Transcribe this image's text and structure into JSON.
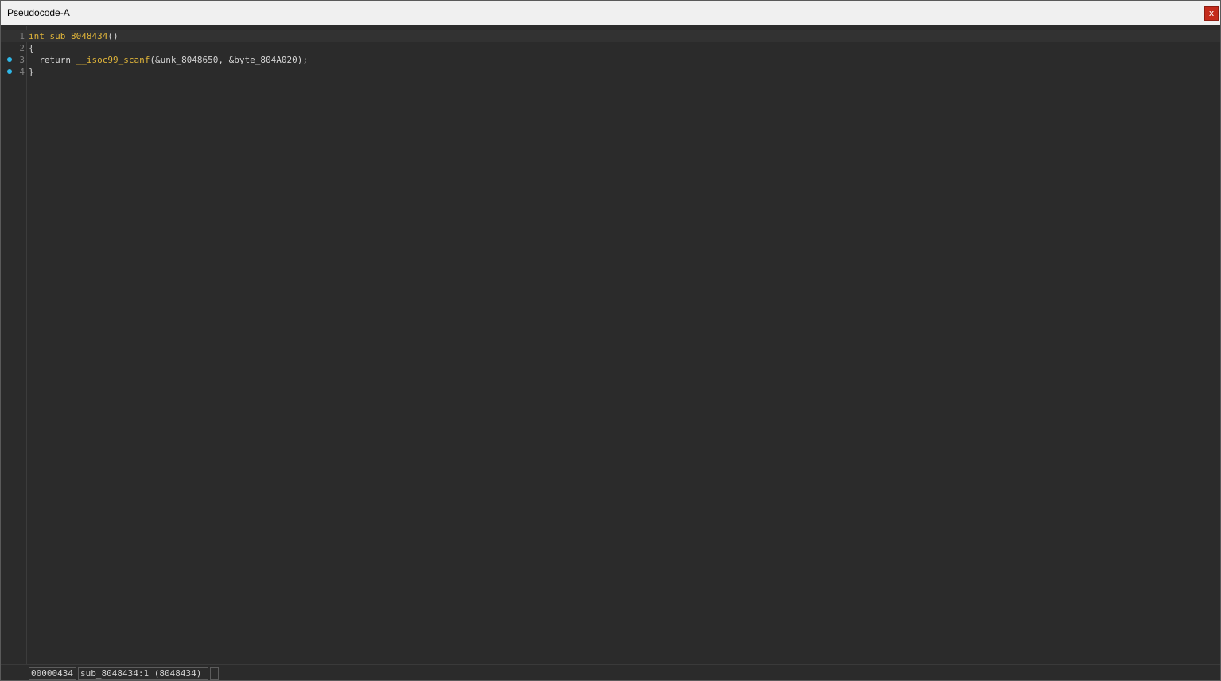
{
  "window": {
    "title": "Pseudocode-A",
    "close_label": "x"
  },
  "code": {
    "lines": [
      {
        "number": "1",
        "breakpoint": false,
        "parts": [
          "int sub_8048434",
          "()"
        ]
      },
      {
        "number": "2",
        "breakpoint": false,
        "parts": [
          "{"
        ]
      },
      {
        "number": "3",
        "breakpoint": true,
        "parts": [
          "  return ",
          "__isoc99_scanf",
          "(&unk_8048650, &byte_804A020);"
        ]
      },
      {
        "number": "4",
        "breakpoint": true,
        "parts": [
          "}"
        ]
      }
    ]
  },
  "status": {
    "address": "00000434",
    "location": "sub_8048434:1 (8048434)",
    "extra": ""
  },
  "colors": {
    "keyword": "#e0b53a",
    "breakpoint": "#2fb8e8",
    "background": "#2b2b2b"
  }
}
